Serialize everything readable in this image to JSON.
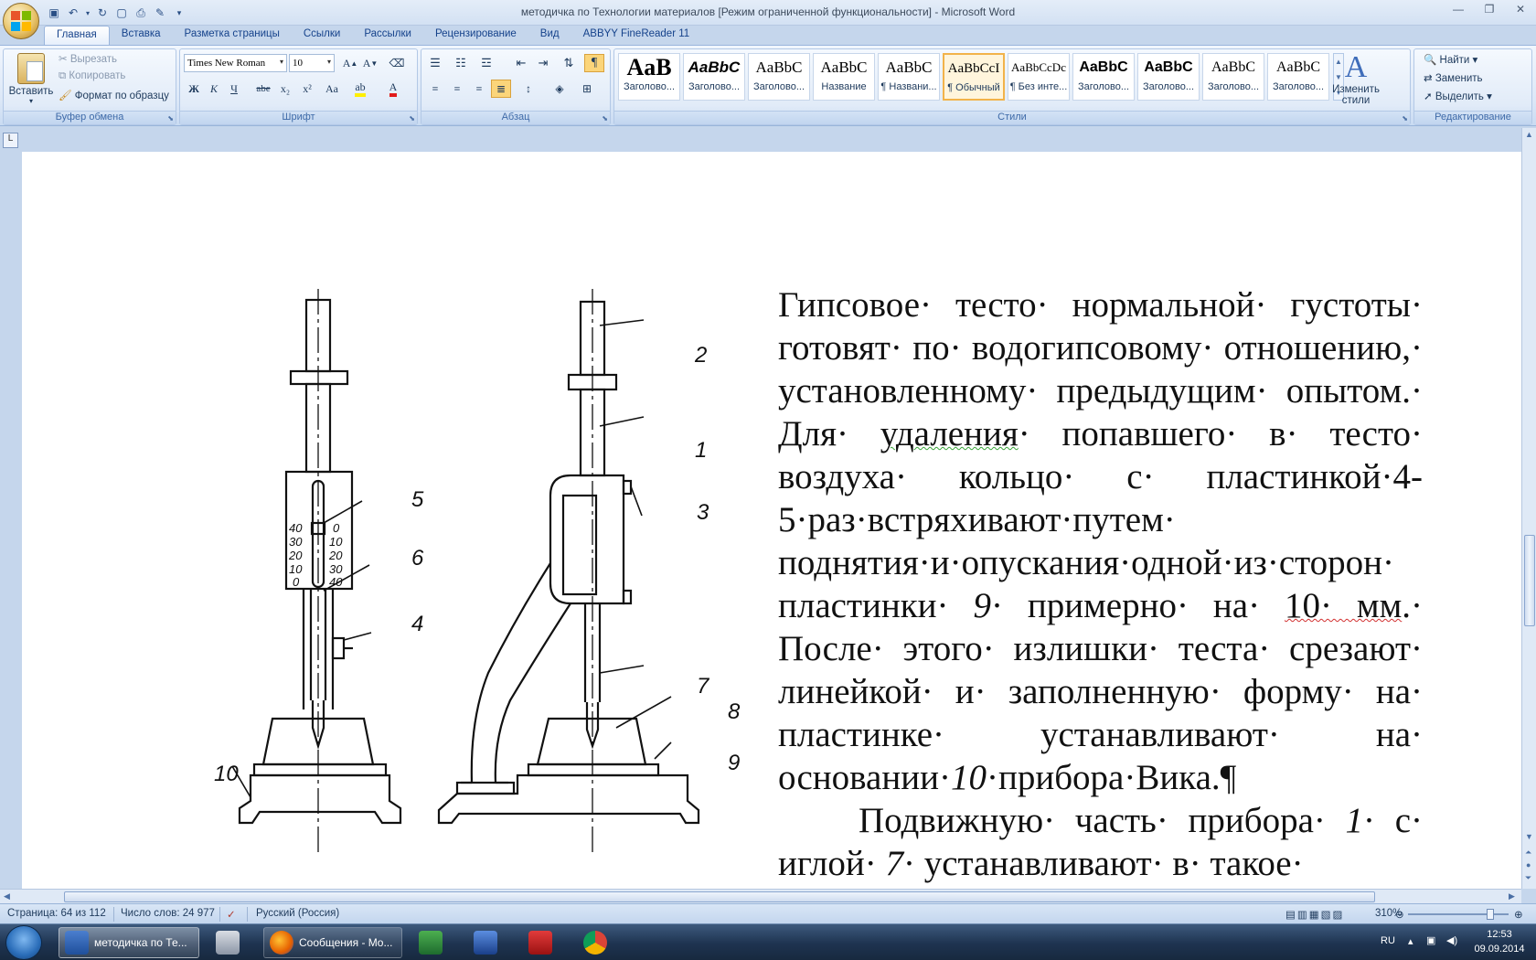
{
  "window": {
    "title": "методичка по Технологии материалов [Режим ограниченной функциональности] - Microsoft Word"
  },
  "tabs": [
    "Главная",
    "Вставка",
    "Разметка страницы",
    "Ссылки",
    "Рассылки",
    "Рецензирование",
    "Вид",
    "ABBYY FineReader 11"
  ],
  "clipboard": {
    "paste": "Вставить",
    "cut": "Вырезать",
    "copy": "Копировать",
    "format_painter": "Формат по образцу",
    "label": "Буфер обмена"
  },
  "font": {
    "name": "Times New Roman",
    "size": "10",
    "label": "Шрифт",
    "bold": "Ж",
    "italic": "К",
    "underline": "Ч",
    "strike": "abe",
    "subscript": "x₂",
    "superscript": "x²",
    "case": "Aa"
  },
  "paragraph": {
    "label": "Абзац"
  },
  "styles": {
    "label": "Стили",
    "items": [
      {
        "preview": "AaB",
        "name": "Заголово..."
      },
      {
        "preview": "AaBbC",
        "name": "Заголово..."
      },
      {
        "preview": "AaBbC",
        "name": "Заголово..."
      },
      {
        "preview": "AaBbC",
        "name": "Название"
      },
      {
        "preview": "AaBbC",
        "name": "¶ Названи..."
      },
      {
        "preview": "AaBbCcI",
        "name": "¶ Обычный"
      },
      {
        "preview": "AaBbCcDc",
        "name": "¶ Без инте..."
      },
      {
        "preview": "AaBbC",
        "name": "Заголово..."
      },
      {
        "preview": "AaBbC",
        "name": "Заголово..."
      },
      {
        "preview": "AaBbC",
        "name": "Заголово..."
      },
      {
        "preview": "AaBbC",
        "name": "Заголово..."
      }
    ],
    "change_styles_l1": "Изменить",
    "change_styles_l2": "стили"
  },
  "editing": {
    "label": "Редактирование",
    "find": "Найти",
    "replace": "Заменить",
    "select": "Выделить"
  },
  "figure": {
    "labels": [
      "1",
      "2",
      "3",
      "4",
      "5",
      "6",
      "7",
      "8",
      "9",
      "10"
    ],
    "scale_left": [
      "40",
      "30",
      "20",
      "10",
      "0"
    ],
    "scale_right": [
      "0",
      "10",
      "20",
      "30",
      "40"
    ]
  },
  "document": {
    "p1_a": "Гипсовое· тесто· нормальной· густоты· готовят· по· водогипсовому· отношению,· установленному· предыдущим· опытом.· Для· ",
    "p1_b": "удаления",
    "p1_c": "· попавшего· в· тесто· воздуха· кольцо· с· пластинкой·4-5·раз·встряхивают·путем· поднятия·и·опускания·одной·из·сторон· пластинки· ",
    "p1_d": "9",
    "p1_e": "· примерно· на· ",
    "p1_f": "10· мм",
    "p1_g": ".· После· этого· излишки· теста· срезают· линейкой· и· заполненную· форму· на· пластинке· устанавливают· на· основании·",
    "p1_h": "10",
    "p1_i": "·прибора·Вика.¶",
    "p2_a": "Подвижную· часть· прибора· ",
    "p2_b": "1",
    "p2_c": "· с· иглой· ",
    "p2_d": "7",
    "p2_e": "· устанавливают· в· такое·"
  },
  "status": {
    "page": "Страница: 64 из 112",
    "words": "Число слов: 24 977",
    "language": "Русский (Россия)",
    "zoom": "310%"
  },
  "taskbar": {
    "items": [
      "методичка по Те...",
      "Сообщения - Mo..."
    ],
    "lang": "RU",
    "time": "12:53",
    "date": "09.09.2014"
  },
  "colors": {
    "accent": "#15428b",
    "selected_style_border": "#f2b34a"
  }
}
